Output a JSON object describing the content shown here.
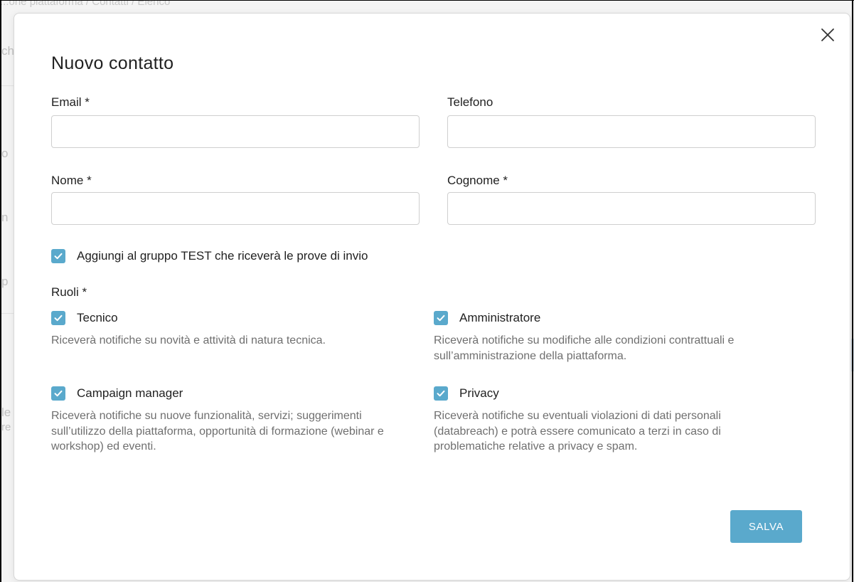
{
  "background": {
    "breadcrumb": "...one piattaforma / Contatti / Elenco",
    "fragments": [
      "ch",
      "o",
      "n",
      "p",
      "le",
      "re"
    ]
  },
  "modal": {
    "title": "Nuovo contatto",
    "close_icon": "close-icon",
    "fields": {
      "email": {
        "label": "Email *",
        "value": "",
        "placeholder": ""
      },
      "telefono": {
        "label": "Telefono",
        "value": "",
        "placeholder": ""
      },
      "nome": {
        "label": "Nome *",
        "value": "",
        "placeholder": ""
      },
      "cognome": {
        "label": "Cognome *",
        "value": "",
        "placeholder": ""
      }
    },
    "test_group": {
      "label": "Aggiungi al gruppo TEST che riceverà le prove di invio",
      "checked": true
    },
    "roles_label": "Ruoli *",
    "roles": [
      {
        "label": "Tecnico",
        "checked": true,
        "description": "Riceverà notifiche su novità e attività di natura tecnica."
      },
      {
        "label": "Amministratore",
        "checked": true,
        "description": "Riceverà notifiche su modifiche alle condizioni contrattuali e sull’amministrazione della piattaforma."
      },
      {
        "label": "Campaign manager",
        "checked": true,
        "description": "Riceverà notifiche su nuove funzionalità, servizi; suggerimenti sull’utilizzo della piattaforma, opportunità di formazione (webinar e workshop) ed eventi."
      },
      {
        "label": "Privacy",
        "checked": true,
        "description": "Riceverà notifiche su eventuali violazioni di dati personali (databreach) e potrà essere comunicato a terzi in caso di problematiche relative a privacy e spam."
      }
    ],
    "save_label": "SALVA"
  },
  "colors": {
    "accent": "#5aa9cc",
    "text": "#212121",
    "muted": "#6f6f6f",
    "border": "#cfcfcf"
  }
}
